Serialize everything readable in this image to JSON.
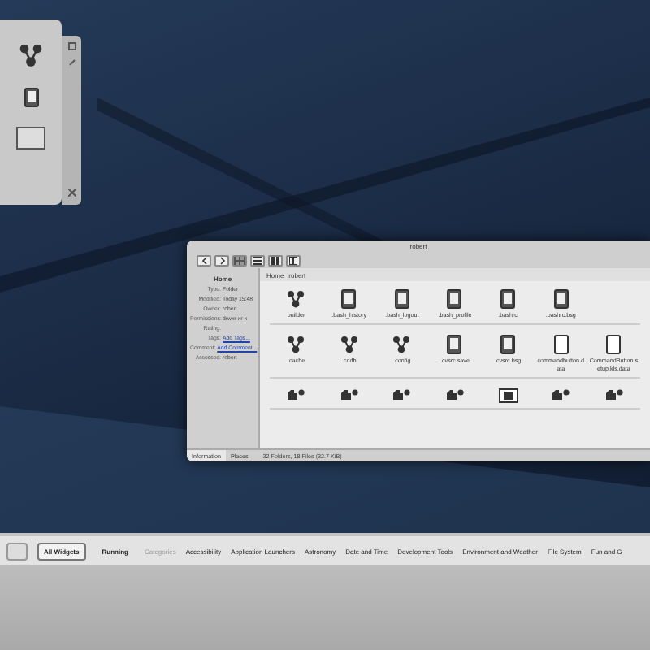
{
  "window": {
    "title": "robert",
    "path": [
      "Home",
      "robert"
    ],
    "view_buttons": [
      {
        "kind": "icons",
        "selected": true
      },
      {
        "kind": "details",
        "selected": false
      },
      {
        "kind": "columns",
        "selected": false
      },
      {
        "kind": "split",
        "selected": false
      }
    ],
    "info_panel": {
      "title": "Home",
      "fields": [
        {
          "label": "Type:",
          "value": "Folder",
          "link": false
        },
        {
          "label": "Modified:",
          "value": "Today 15:48",
          "link": false
        },
        {
          "label": "Owner:",
          "value": "robert",
          "link": false
        },
        {
          "label": "Permissions:",
          "value": "drwxr-xr-x",
          "link": false
        },
        {
          "label": "Rating:"
        },
        {
          "label": "Tags:",
          "value": "Add Tags...",
          "link": true
        },
        {
          "label": "Comment:",
          "value": "Add Comment...",
          "link": true
        },
        {
          "label": "Accessed:",
          "value": "robert",
          "link": false
        }
      ]
    },
    "rows": [
      [
        {
          "name": "builder",
          "kind": "folder"
        },
        {
          "name": ".bash_history",
          "kind": "text"
        },
        {
          "name": ".bash_logout",
          "kind": "text"
        },
        {
          "name": ".bash_profile",
          "kind": "text"
        },
        {
          "name": ".bashrc",
          "kind": "text"
        },
        {
          "name": ".bashrc.bsg",
          "kind": "text"
        }
      ],
      [
        {
          "name": ".cache",
          "kind": "folder"
        },
        {
          "name": ".cddb",
          "kind": "folder"
        },
        {
          "name": ".config",
          "kind": "folder"
        },
        {
          "name": ".cvsrc.save",
          "kind": "text"
        },
        {
          "name": ".cvsrc.bsg",
          "kind": "text"
        },
        {
          "name": "commandbutton.d ata",
          "kind": "blank"
        },
        {
          "name": "CommandButton.s etup.kls.data",
          "kind": "blank"
        }
      ],
      [
        {
          "kind": "folder"
        },
        {
          "kind": "folder"
        },
        {
          "kind": "folder"
        },
        {
          "kind": "folder"
        },
        {
          "kind": "image"
        },
        {
          "kind": "folder"
        },
        {
          "kind": "folder"
        }
      ]
    ],
    "panel_tabs": [
      {
        "label": "Information",
        "selected": true
      },
      {
        "label": "Places",
        "selected": false
      }
    ],
    "status": "32 Folders, 18 Files (32.7 KiB)"
  },
  "widget_bar": {
    "buttons": [
      {
        "label": "All Widgets",
        "selected": true
      },
      {
        "label": "Running",
        "selected": false
      }
    ],
    "categories": [
      {
        "label": "Categories",
        "disabled": true
      },
      {
        "label": "Accessibility",
        "disabled": false
      },
      {
        "label": "Application Launchers",
        "disabled": false
      },
      {
        "label": "Astronomy",
        "disabled": false
      },
      {
        "label": "Date and Time",
        "disabled": false
      },
      {
        "label": "Development Tools",
        "disabled": false
      },
      {
        "label": "Environment and Weather",
        "disabled": false
      },
      {
        "label": "File System",
        "disabled": false
      },
      {
        "label": "Fun and G",
        "disabled": false
      }
    ]
  }
}
